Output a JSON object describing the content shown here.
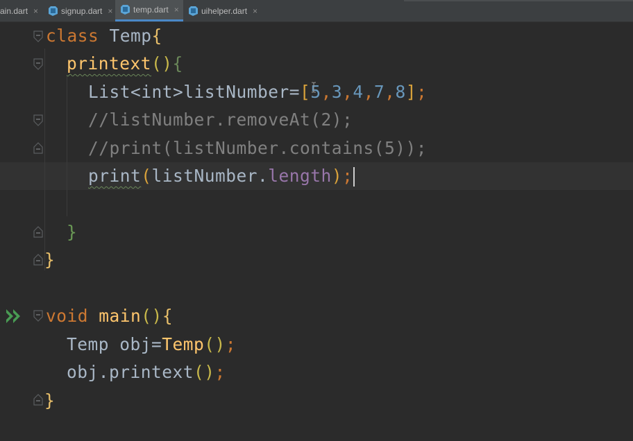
{
  "tabs": [
    {
      "label": "ain.dart",
      "active": false
    },
    {
      "label": "signup.dart",
      "active": false
    },
    {
      "label": "temp.dart",
      "active": true
    },
    {
      "label": "uihelper.dart",
      "active": false
    }
  ],
  "tab_close_glyph": "×",
  "code": {
    "l1": {
      "kw": "class",
      "name": "Temp",
      "brace": "{"
    },
    "l2": {
      "fn": "printext",
      "parens": "()",
      "brace": "{"
    },
    "l3": {
      "type": "List<int>",
      "var": "listNumber",
      "eq": "=",
      "open": "[",
      "n1": "5",
      "n2": "3",
      "n3": "4",
      "n4": "7",
      "n5": "8",
      "close": "]",
      "semi": ";",
      "comma": ","
    },
    "l4": {
      "comment": "//listNumber.removeAt(2);"
    },
    "l5": {
      "comment": "//print(listNumber.contains(5));"
    },
    "l6": {
      "fn": "print",
      "open": "(",
      "obj": "listNumber.",
      "prop": "length",
      "close": ")",
      "semi": ";"
    },
    "l8": {
      "brace": "}"
    },
    "l9": {
      "brace": "}"
    },
    "l11": {
      "kw": "void",
      "fn": "main",
      "parens": "()",
      "brace": "{"
    },
    "l12": {
      "type": "Temp",
      "var": " obj=",
      "ctor": "Temp",
      "parens": "()",
      "semi": ";"
    },
    "l13": {
      "obj": "obj.printext",
      "parens": "()",
      "semi": ";"
    },
    "l14": {
      "brace": "}"
    }
  },
  "colors": {
    "background": "#2b2b2b",
    "keyword": "#cc7832",
    "function": "#ffc66d",
    "number": "#6897bb",
    "comment": "#808080",
    "property": "#9876aa",
    "run_icon": "#499c54",
    "active_tab_underline": "#4a88c7"
  }
}
